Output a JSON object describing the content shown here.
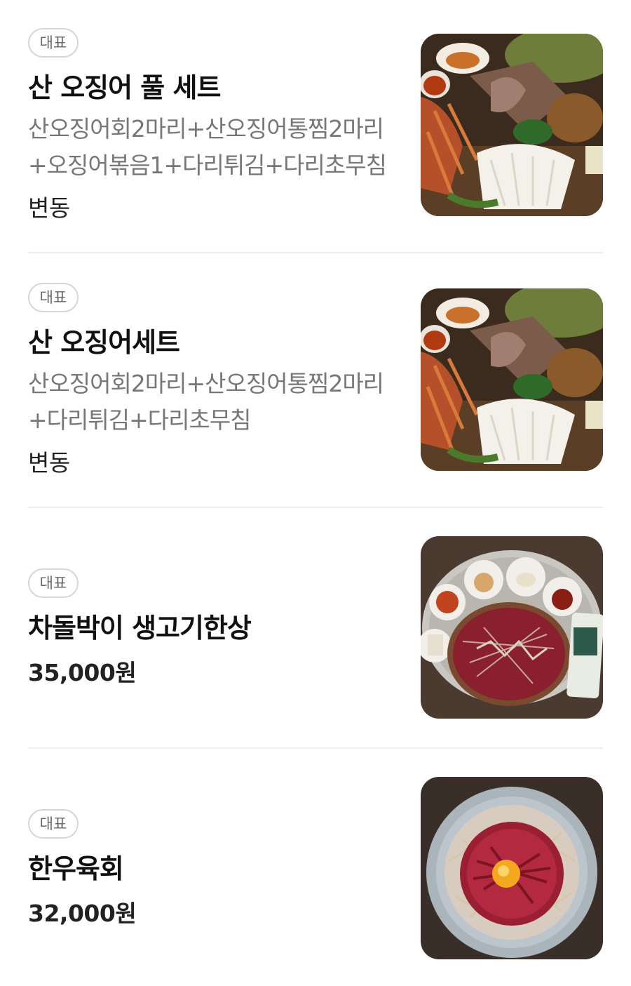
{
  "menu": {
    "items": [
      {
        "badge": "대표",
        "name": "산 오징어 풀 세트",
        "description": "산오징어회2마리+산오징어통찜2마리+오징어볶음1+다리튀김+다리초무침",
        "price": "변동",
        "image": "squid-full-set-photo"
      },
      {
        "badge": "대표",
        "name": "산 오징어세트",
        "description": "산오징어회2마리+산오징어통찜2마리+다리튀김+다리초무침",
        "price": "변동",
        "image": "squid-set-photo"
      },
      {
        "badge": "대표",
        "name": "차돌박이 생고기한상",
        "price": "35,000원",
        "image": "raw-beef-table-photo"
      },
      {
        "badge": "대표",
        "name": "한우육회",
        "price": "32,000원",
        "image": "hanwoo-yukhoe-photo"
      }
    ]
  },
  "colors": {
    "badge_border": "#d6d6d6",
    "divider": "#eeeeee",
    "desc_text": "#777777"
  }
}
